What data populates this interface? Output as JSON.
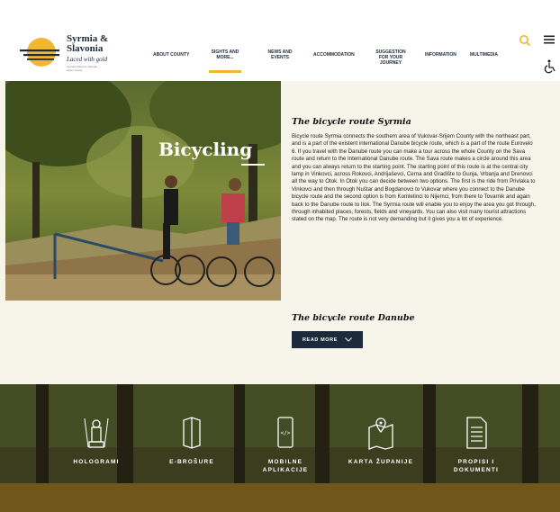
{
  "brand": {
    "name_line1": "Syrmia &",
    "name_line2": "Slavonia",
    "tagline": "Laced with gold",
    "subtext": "touristic board of vukovar-srijem county"
  },
  "nav": {
    "items": [
      {
        "label": "ABOUT COUNTY"
      },
      {
        "label": "SIGHTS AND MORE..."
      },
      {
        "label": "NEWS AND EVENTS"
      },
      {
        "label": "ACCOMMODATION"
      },
      {
        "label": "SUGGESTION FOR YOUR JOURNEY"
      },
      {
        "label": "INFORMATION"
      },
      {
        "label": "MULTIMEDIA"
      }
    ],
    "active_index": 1
  },
  "icons": {
    "search": "search-icon",
    "menu": "hamburger-menu-icon",
    "accessibility": "wheelchair-accessibility-icon"
  },
  "hero": {
    "title": "Bicycling"
  },
  "article": {
    "title": "The bicycle route Syrmia",
    "body": "Bicycle route Syrmia connects the southern area of Vukovar-Srijem County with the northeast part, and is a part of the existent international Danube bicycle route, which is a part of the route Eurovelo 6. If you travel with the Danube route you can make a tour across the whole County on the Sava route and return to the International Danube route. The Sava route makes a circle around this area and you can always return to the starting point. The starting point of this route is at the central city lamp in Vinkovci, across Rokovci, Andrijaševci, Cerna and Gradište to Gunja, Vrbanja and Drenovci all the way to Otok. In Otok you can decide between two options. The first is the ride from Privlaka to Vinkovci and then through Nuštar and Bogdanovci to Vukovar where you connect to the Danube bicycle route and the second option is from Komletinci to Nijemci, from there to Tovarnik and again back to the Danube route to Ilok. The Syrmia route will enable you to enjoy the area you got through, through inhabited places, forests, fields and vineyards. You can also visit many tourist attractions stated on the map. The route is not very demanding but it gives you a lot of experience.",
    "next_title": "The bicycle route Danube",
    "read_more": "READ MORE"
  },
  "footer": {
    "items": [
      {
        "label": "HOLOGRAMI",
        "icon": "hologram-monument-icon"
      },
      {
        "label": "E-BROŠURE",
        "icon": "brochure-icon"
      },
      {
        "label": "MOBILNE APLIKACIJE",
        "icon": "mobile-app-icon"
      },
      {
        "label": "KARTA ŽUPANIJE",
        "icon": "map-icon"
      },
      {
        "label": "PROPISI I DOKUMENTI",
        "icon": "document-icon"
      }
    ]
  },
  "colors": {
    "accent": "#f2b632",
    "navy": "#1d2a3a",
    "content_bg": "#f7f4ea"
  }
}
